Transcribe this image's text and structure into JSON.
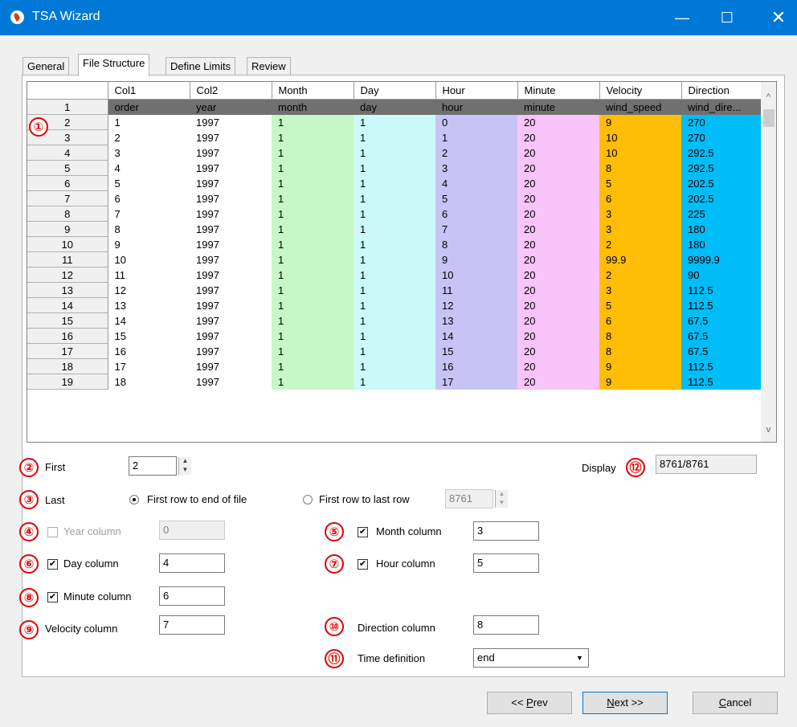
{
  "window": {
    "title": "TSA Wizard",
    "minimize": "—",
    "maximize": "☐",
    "close": "✕"
  },
  "tabs": [
    "General",
    "File Structure",
    "Define Limits",
    "Review"
  ],
  "grid": {
    "columns": [
      "Col1",
      "Col2",
      "Month",
      "Day",
      "Hour",
      "Minute",
      "Velocity",
      "Direction"
    ],
    "column_colors": [
      "#ffffff",
      "#ffffff",
      "#c6f7c6",
      "#ccfafa",
      "#c8c3f5",
      "#f9c4f9",
      "#ffbd05",
      "#00bdf7"
    ],
    "rows": [
      {
        "n": "1",
        "cells": [
          "order",
          "year",
          "month",
          "day",
          "hour",
          "minute",
          "wind_speed",
          "wind_dire..."
        ]
      },
      {
        "n": "2",
        "cells": [
          "1",
          "1997",
          "1",
          "1",
          "0",
          "20",
          "9",
          "270"
        ]
      },
      {
        "n": "3",
        "cells": [
          "2",
          "1997",
          "1",
          "1",
          "1",
          "20",
          "10",
          "270"
        ]
      },
      {
        "n": "4",
        "cells": [
          "3",
          "1997",
          "1",
          "1",
          "2",
          "20",
          "10",
          "292.5"
        ]
      },
      {
        "n": "5",
        "cells": [
          "4",
          "1997",
          "1",
          "1",
          "3",
          "20",
          "8",
          "292.5"
        ]
      },
      {
        "n": "6",
        "cells": [
          "5",
          "1997",
          "1",
          "1",
          "4",
          "20",
          "5",
          "202.5"
        ]
      },
      {
        "n": "7",
        "cells": [
          "6",
          "1997",
          "1",
          "1",
          "5",
          "20",
          "6",
          "202.5"
        ]
      },
      {
        "n": "8",
        "cells": [
          "7",
          "1997",
          "1",
          "1",
          "6",
          "20",
          "3",
          "225"
        ]
      },
      {
        "n": "9",
        "cells": [
          "8",
          "1997",
          "1",
          "1",
          "7",
          "20",
          "3",
          "180"
        ]
      },
      {
        "n": "10",
        "cells": [
          "9",
          "1997",
          "1",
          "1",
          "8",
          "20",
          "2",
          "180"
        ]
      },
      {
        "n": "11",
        "cells": [
          "10",
          "1997",
          "1",
          "1",
          "9",
          "20",
          "99.9",
          "9999.9"
        ]
      },
      {
        "n": "12",
        "cells": [
          "11",
          "1997",
          "1",
          "1",
          "10",
          "20",
          "2",
          "90"
        ]
      },
      {
        "n": "13",
        "cells": [
          "12",
          "1997",
          "1",
          "1",
          "11",
          "20",
          "3",
          "112.5"
        ]
      },
      {
        "n": "14",
        "cells": [
          "13",
          "1997",
          "1",
          "1",
          "12",
          "20",
          "5",
          "112.5"
        ]
      },
      {
        "n": "15",
        "cells": [
          "14",
          "1997",
          "1",
          "1",
          "13",
          "20",
          "6",
          "67.5"
        ]
      },
      {
        "n": "16",
        "cells": [
          "15",
          "1997",
          "1",
          "1",
          "14",
          "20",
          "8",
          "67.5"
        ]
      },
      {
        "n": "17",
        "cells": [
          "16",
          "1997",
          "1",
          "1",
          "15",
          "20",
          "8",
          "67.5"
        ]
      },
      {
        "n": "18",
        "cells": [
          "17",
          "1997",
          "1",
          "1",
          "16",
          "20",
          "9",
          "112.5"
        ]
      },
      {
        "n": "19",
        "cells": [
          "18",
          "1997",
          "1",
          "1",
          "17",
          "20",
          "9",
          "112.5"
        ]
      }
    ],
    "scroll_up": "^",
    "scroll_down": "v"
  },
  "annotations": [
    "①",
    "②",
    "③",
    "④",
    "⑤",
    "⑥",
    "⑦",
    "⑧",
    "⑨",
    "⑩",
    "⑪",
    "⑫"
  ],
  "form": {
    "first_label": "First",
    "first_value": "2",
    "display_label": "Display",
    "display_value": "8761/8761",
    "last_label": "Last",
    "radio_end_label": "First row to end of file",
    "radio_last_label": "First row to last row",
    "last_row_value": "8761",
    "year_label": "Year column",
    "year_value": "0",
    "month_label": "Month column",
    "month_value": "3",
    "day_label": "Day column",
    "day_value": "4",
    "hour_label": "Hour column",
    "hour_value": "5",
    "minute_label": "Minute column",
    "minute_value": "6",
    "velocity_label": "Velocity column",
    "velocity_value": "7",
    "direction_label": "Direction column",
    "direction_value": "8",
    "time_def_label": "Time definition",
    "time_def_value": "end",
    "checkmark": "✔"
  },
  "buttons": {
    "prev_prefix": "<< ",
    "prev_u": "P",
    "prev_rest": "rev",
    "next_u": "N",
    "next_rest": "ext >>",
    "cancel_u": "C",
    "cancel_rest": "ancel"
  }
}
